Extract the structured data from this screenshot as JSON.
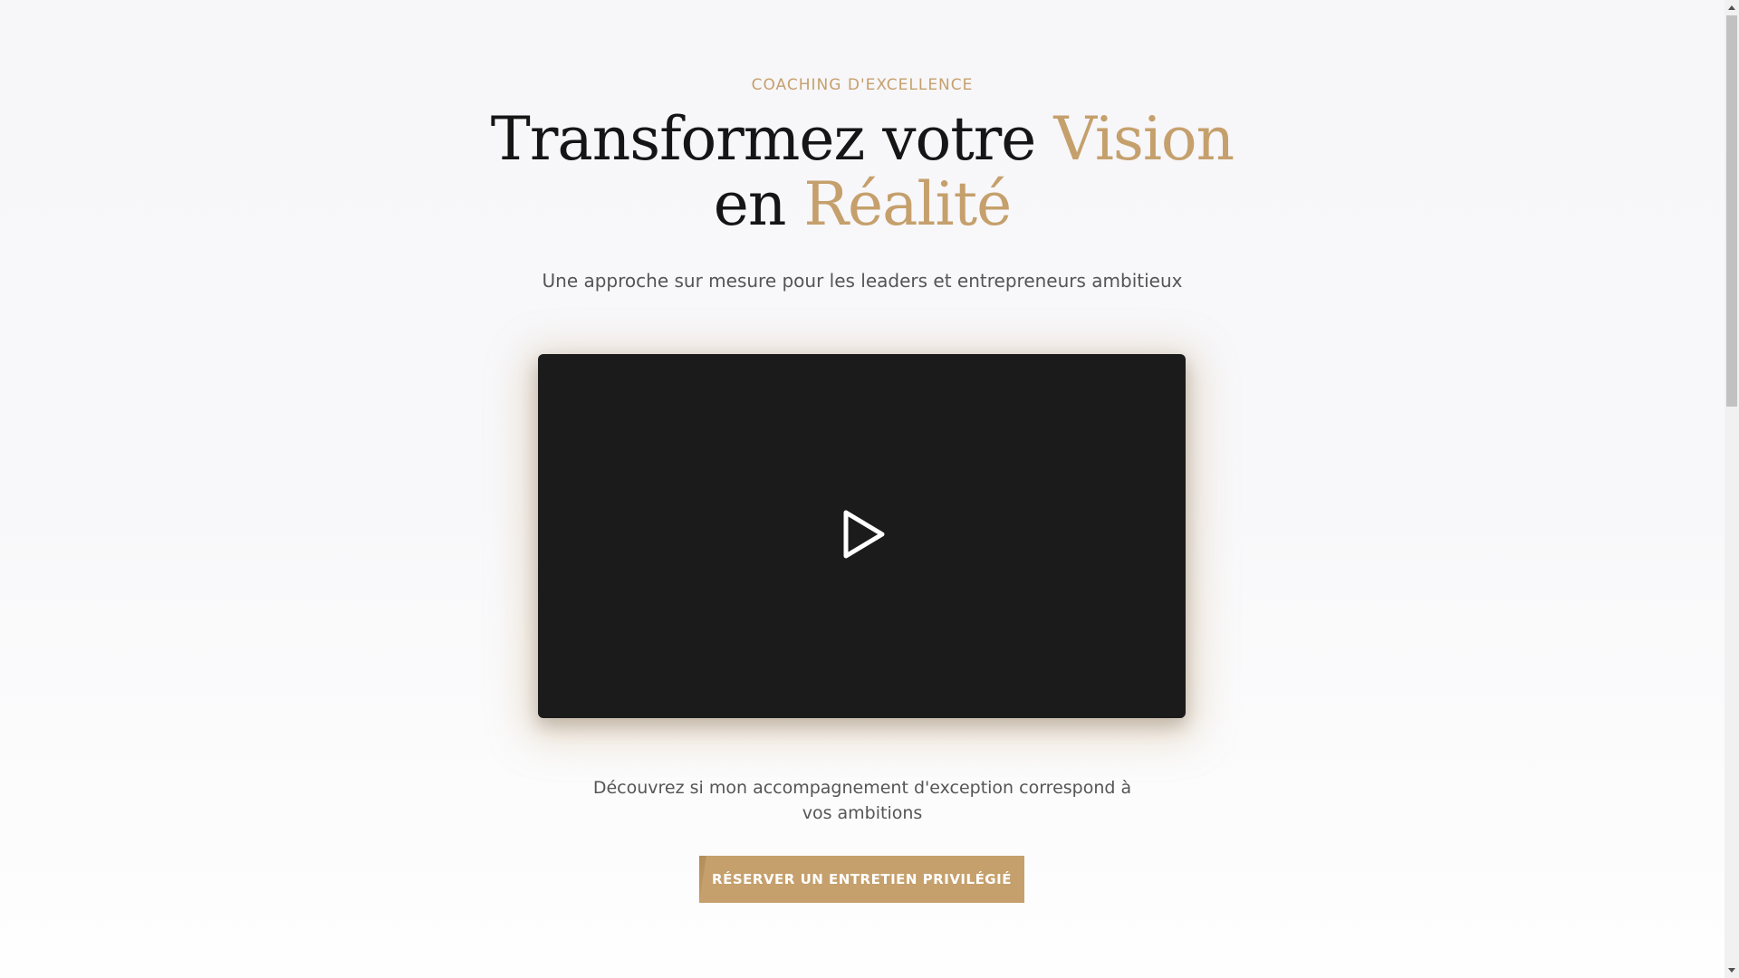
{
  "hero": {
    "eyebrow": "COACHING D'EXCELLENCE",
    "headline": {
      "part1": "Transformez votre ",
      "accent1": "Vision",
      "part2": "en ",
      "accent2": "Réalité"
    },
    "subtitle": "Une approche sur mesure pour les leaders et entrepreneurs ambitieux"
  },
  "video": {
    "play_icon": "play-icon"
  },
  "cta_section": {
    "description": "Découvrez si mon accompagnement d'exception correspond à vos ambitions",
    "button_label": "RÉSERVER UN ENTRETIEN PRIVILÉGIÉ"
  },
  "colors": {
    "accent": "#c5a06c",
    "text_dark": "#151515",
    "text_muted": "#555555",
    "video_bg": "#1b1b1b"
  }
}
